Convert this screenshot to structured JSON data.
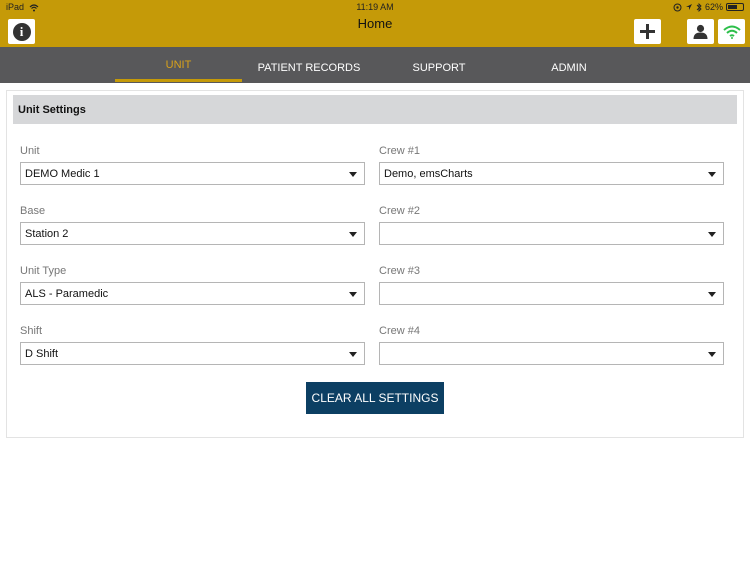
{
  "status_bar": {
    "device": "iPad",
    "time": "11:19 AM",
    "battery": "62%",
    "battery_level": 0.62
  },
  "header": {
    "title": "Home"
  },
  "nav": {
    "tabs": [
      "UNIT",
      "PATIENT RECORDS",
      "SUPPORT",
      "ADMIN"
    ],
    "active_tab": "UNIT"
  },
  "unit_settings": {
    "title": "Unit Settings",
    "left_fields": [
      {
        "label": "Unit",
        "value": "DEMO Medic 1"
      },
      {
        "label": "Base",
        "value": "Station 2"
      },
      {
        "label": "Unit Type",
        "value": "ALS - Paramedic"
      },
      {
        "label": "Shift",
        "value": "D Shift"
      }
    ],
    "right_fields": [
      {
        "label": "Crew #1",
        "value": "Demo, emsCharts"
      },
      {
        "label": "Crew #2",
        "value": ""
      },
      {
        "label": "Crew #3",
        "value": ""
      },
      {
        "label": "Crew #4",
        "value": ""
      }
    ],
    "clear_button": "CLEAR ALL SETTINGS"
  },
  "colors": {
    "header_bg": "#c59a08",
    "nav_bg": "#58585a",
    "active_tab": "#d9a21a",
    "button_bg": "#0c3f63",
    "wifi": "#2dbf4a"
  }
}
